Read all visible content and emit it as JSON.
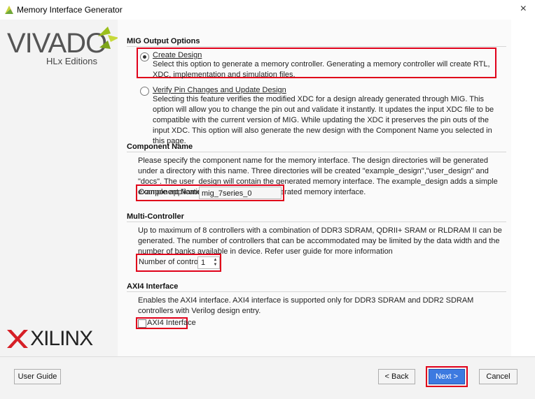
{
  "window": {
    "title": "Memory Interface Generator",
    "close_glyph": "×"
  },
  "brand": {
    "vivado": "VIVADO",
    "vivado_sub": "HLx Editions",
    "xilinx": "XILINX"
  },
  "mig_output": {
    "section_title": "MIG Output Options",
    "create_design": {
      "label": "Create Design",
      "selected": true,
      "description": "Select this option to generate a memory controller. Generating a memory controller will create RTL, XDC, implementation and simulation files."
    },
    "verify_pin": {
      "label": "Verify Pin Changes and Update Design",
      "selected": false,
      "description": "Selecting this feature verifies the modified XDC for a design already generated through MIG. This option will allow you to change the pin out and validate it instantly. It updates the input XDC file to be compatible with the current version of MIG. While updating the XDC it preserves the pin outs of the input XDC. This option will also generate the new design with the Component Name you selected in this page."
    }
  },
  "component": {
    "section_title": "Component Name",
    "description": "Please specify the component name for the memory interface. The design directories will be generated under a directory with this name. Three directories will be created \"example_design\",\"user_design\" and \"docs\". The user_design will contain the generated memory interface. The example_design adds a simple example application connected to the generated memory interface.",
    "field_label": "Component Name",
    "field_value": "mig_7series_0"
  },
  "multi_controller": {
    "section_title": "Multi-Controller",
    "description": "Up to maximum of 8 controllers with a combination of DDR3 SDRAM, QDRII+ SRAM or RLDRAM II can be generated. The number of controllers that can be accommodated may be limited by the data width and the number of banks available in device. Refer user guide for more information",
    "field_label": "Number of controllers",
    "value": "1"
  },
  "axi4": {
    "section_title": "AXI4 Interface",
    "description": "Enables the AXI4 interface. AXI4 interface is supported only for DDR3 SDRAM and DDR2 SDRAM controllers with Verilog design entry.",
    "checkbox_label": "AXI4 Interface",
    "checked": false
  },
  "footer": {
    "user_guide": "User Guide",
    "back": "< Back",
    "next": "Next >",
    "cancel": "Cancel"
  },
  "colors": {
    "highlight": "#e0001a",
    "primary_button": "#3d7ae0",
    "vivado_mark": "#9bbf1c"
  }
}
